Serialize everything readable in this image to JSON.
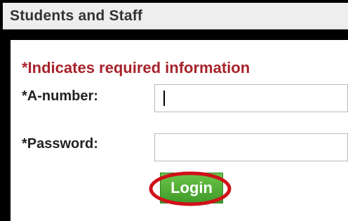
{
  "header": {
    "title": "Students and Staff"
  },
  "form": {
    "required_note": "*Indicates required information",
    "anumber_label": "*A-number:",
    "anumber_value": "",
    "password_label": "*Password:",
    "password_value": "",
    "login_label": "Login"
  },
  "colors": {
    "required_text": "#a8232b",
    "login_button": "#4caf34",
    "highlight_ring": "#d0101a"
  }
}
